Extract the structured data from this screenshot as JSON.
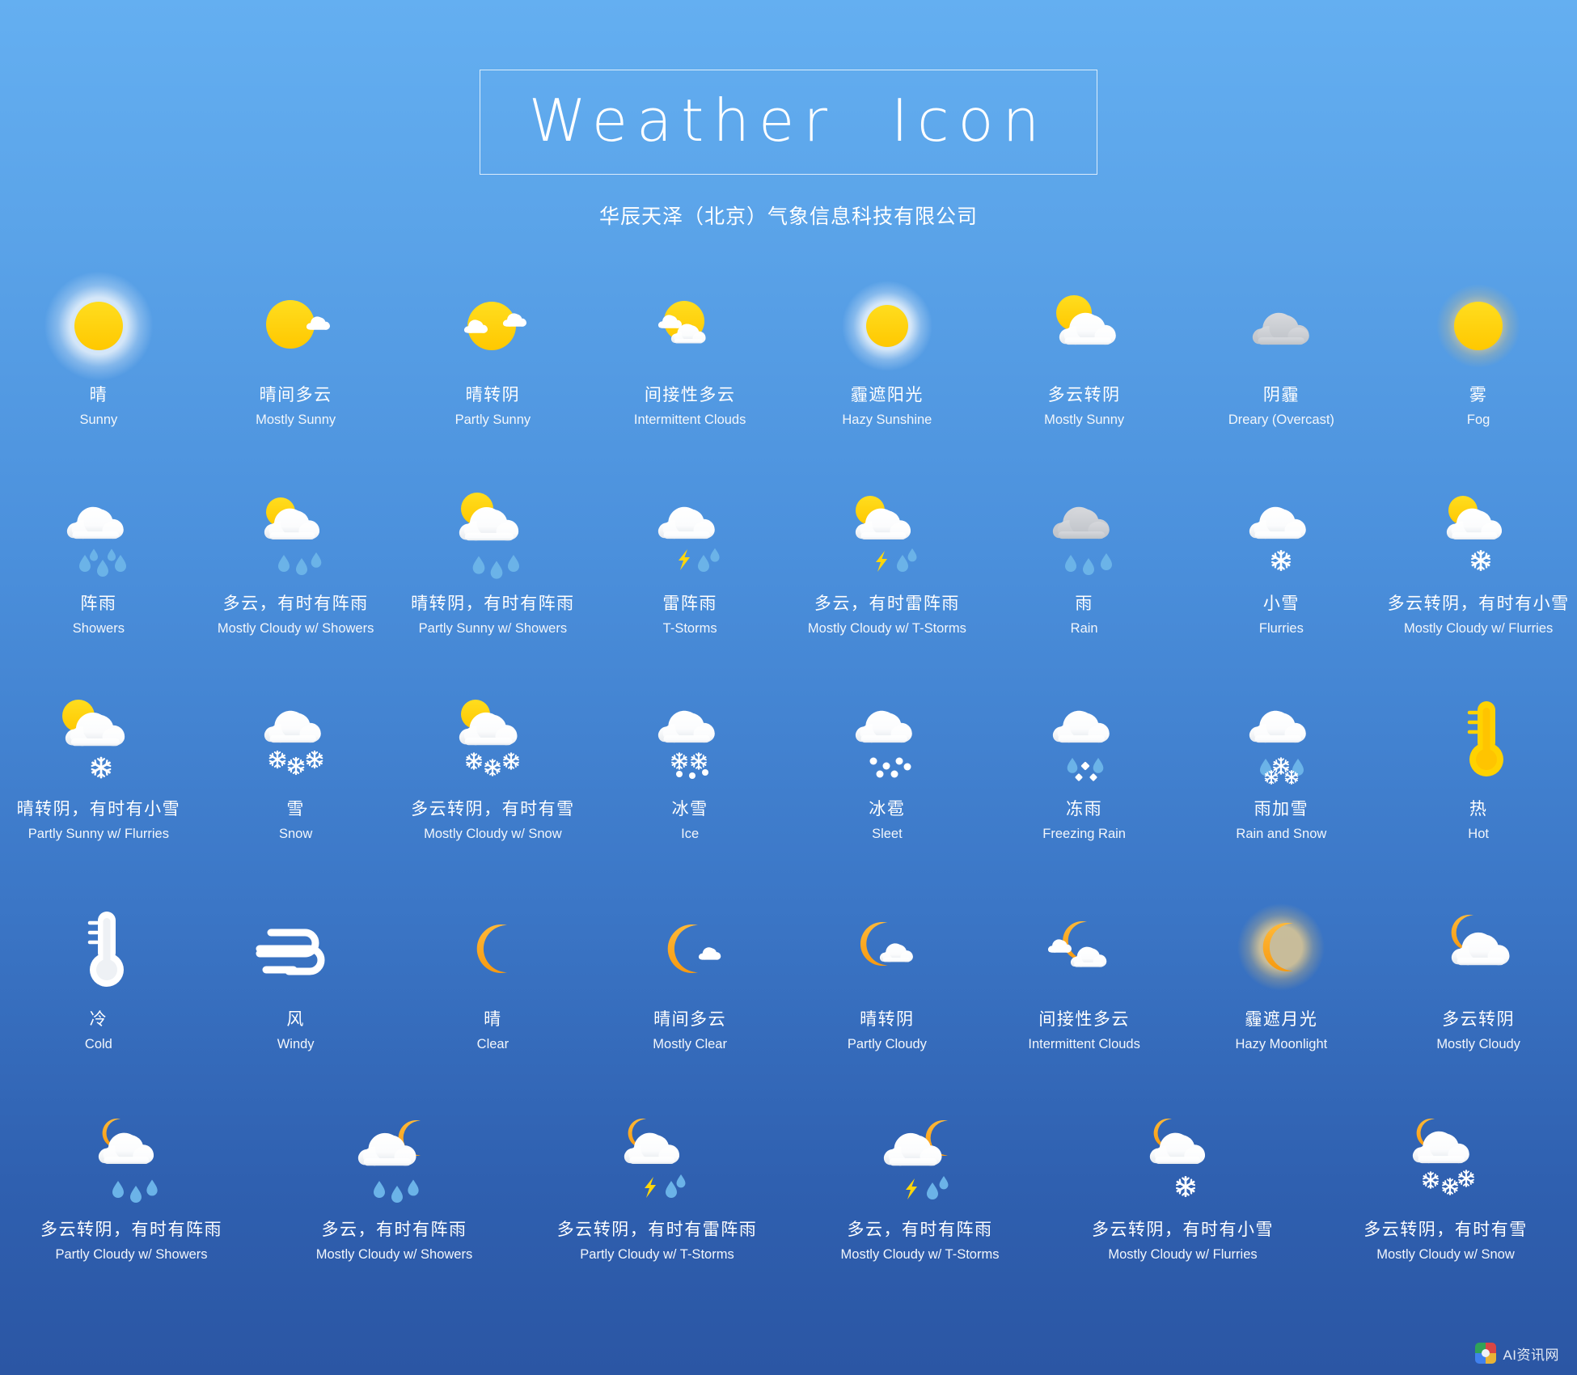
{
  "header": {
    "title": "Weather  Icon",
    "subtitle": "华辰天泽（北京）气象信息科技有限公司"
  },
  "watermark": {
    "text": "AI资讯网"
  },
  "colors": {
    "sky_top": "#64AFF1",
    "sky_bottom": "#2B56A4",
    "sun_yellow": "#FFD60A",
    "moon_orange": "#F5A623",
    "cloud_white": "#FFFFFF",
    "cloud_grey": "#C9CCD1",
    "rain_blue": "#6BB3E8",
    "lightning_yellow": "#FFD60A",
    "snow_white": "#FFFFFF",
    "label_text": "#FFFFFF"
  },
  "rows": [
    {
      "index": 1,
      "cells": [
        {
          "icon": "sun-glow-icon",
          "cn": "晴",
          "en": "Sunny"
        },
        {
          "icon": "sun-small-cloud-icon",
          "cn": "晴间多云",
          "en": "Mostly Sunny"
        },
        {
          "icon": "sun-two-clouds-icon",
          "cn": "晴转阴",
          "en": "Partly Sunny"
        },
        {
          "icon": "sun-behind-cloud-icon",
          "cn": "间接性多云",
          "en": "Intermittent Clouds"
        },
        {
          "icon": "hazy-sun-icon",
          "cn": "霾遮阳光",
          "en": "Hazy Sunshine"
        },
        {
          "icon": "sun-big-cloud-icon",
          "cn": "多云转阴",
          "en": "Mostly Sunny"
        },
        {
          "icon": "grey-cloud-icon",
          "cn": "阴霾",
          "en": "Dreary (Overcast)"
        },
        {
          "icon": "fog-sun-icon",
          "cn": "雾",
          "en": "Fog"
        }
      ]
    },
    {
      "index": 2,
      "cells": [
        {
          "icon": "cloud-showers-icon",
          "cn": "阵雨",
          "en": "Showers"
        },
        {
          "icon": "sun-cloud-showers-icon",
          "cn": "多云，有时有阵雨",
          "en": "Mostly Cloudy w/ Showers"
        },
        {
          "icon": "sun-cloud-showers-big-icon",
          "cn": "晴转阴，有时有阵雨",
          "en": "Partly Sunny w/ Showers"
        },
        {
          "icon": "cloud-tstorm-icon",
          "cn": "雷阵雨",
          "en": "T-Storms"
        },
        {
          "icon": "sun-cloud-tstorm-icon",
          "cn": "多云，有时雷阵雨",
          "en": "Mostly Cloudy w/ T-Storms"
        },
        {
          "icon": "grey-cloud-rain-icon",
          "cn": "雨",
          "en": "Rain"
        },
        {
          "icon": "cloud-flurries-icon",
          "cn": "小雪",
          "en": "Flurries"
        },
        {
          "icon": "sun-cloud-flurries-icon",
          "cn": "多云转阴，有时有小雪",
          "en": "Mostly Cloudy w/ Flurries"
        }
      ]
    },
    {
      "index": 3,
      "cells": [
        {
          "icon": "sun-cloud-flurries-big-icon",
          "cn": "晴转阴，有时有小雪",
          "en": "Partly Sunny w/ Flurries"
        },
        {
          "icon": "cloud-snow-icon",
          "cn": "雪",
          "en": "Snow"
        },
        {
          "icon": "sun-cloud-snow-icon",
          "cn": "多云转阴，有时有雪",
          "en": "Mostly Cloudy w/ Snow"
        },
        {
          "icon": "cloud-ice-icon",
          "cn": "冰雪",
          "en": "Ice"
        },
        {
          "icon": "cloud-sleet-icon",
          "cn": "冰雹",
          "en": "Sleet"
        },
        {
          "icon": "cloud-freezing-rain-icon",
          "cn": "冻雨",
          "en": "Freezing Rain"
        },
        {
          "icon": "cloud-rain-snow-icon",
          "cn": "雨加雪",
          "en": "Rain and Snow"
        },
        {
          "icon": "thermometer-hot-icon",
          "cn": "热",
          "en": "Hot"
        }
      ]
    },
    {
      "index": 4,
      "cells": [
        {
          "icon": "thermometer-cold-icon",
          "cn": "冷",
          "en": "Cold"
        },
        {
          "icon": "wind-icon",
          "cn": "风",
          "en": "Windy"
        },
        {
          "icon": "moon-icon",
          "cn": "晴",
          "en": "Clear"
        },
        {
          "icon": "moon-small-cloud-icon",
          "cn": "晴间多云",
          "en": "Mostly Clear"
        },
        {
          "icon": "moon-cloud-icon",
          "cn": "晴转阴",
          "en": "Partly Cloudy"
        },
        {
          "icon": "moon-two-clouds-icon",
          "cn": "间接性多云",
          "en": "Intermittent Clouds"
        },
        {
          "icon": "hazy-moon-icon",
          "cn": "霾遮月光",
          "en": "Hazy Moonlight"
        },
        {
          "icon": "moon-big-cloud-icon",
          "cn": "多云转阴",
          "en": "Mostly Cloudy"
        }
      ]
    },
    {
      "index": 5,
      "cells": [
        {
          "icon": "moon-cloud-showers-icon",
          "cn": "多云转阴，有时有阵雨",
          "en": "Partly Cloudy w/ Showers"
        },
        {
          "icon": "moon-cloud-showers-big-icon",
          "cn": "多云，有时有阵雨",
          "en": "Mostly Cloudy w/ Showers"
        },
        {
          "icon": "moon-cloud-tstorm-icon",
          "cn": "多云转阴，有时有雷阵雨",
          "en": "Partly Cloudy w/ T-Storms"
        },
        {
          "icon": "moon-cloud-tstorm-big-icon",
          "cn": "多云，有时有阵雨",
          "en": "Mostly Cloudy w/ T-Storms"
        },
        {
          "icon": "moon-cloud-flurries-icon",
          "cn": "多云转阴，有时有小雪",
          "en": "Mostly Cloudy w/ Flurries"
        },
        {
          "icon": "moon-cloud-snow-icon",
          "cn": "多云转阴，有时有雪",
          "en": "Mostly Cloudy w/ Snow"
        }
      ]
    }
  ]
}
